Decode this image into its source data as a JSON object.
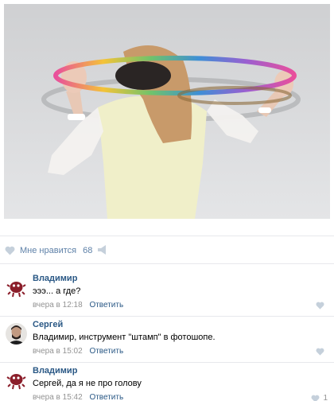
{
  "post": {
    "like_label": "Мне нравится",
    "like_count": "68"
  },
  "comments": [
    {
      "author": "Владимир",
      "text": "эээ... а где?",
      "time": "вчера в 12:18",
      "reply": "Ответить",
      "likes": ""
    },
    {
      "author": "Сергей",
      "text": "Владимир, инструмент \"штамп\" в фотошопе.",
      "time": "вчера в 15:02",
      "reply": "Ответить",
      "likes": ""
    },
    {
      "author": "Владимир",
      "text": "Сергей, да я не про голову",
      "time": "вчера в 15:42",
      "reply": "Ответить",
      "likes": "1"
    }
  ],
  "colors": {
    "link": "#2a5885",
    "like_blue": "#5e81a8",
    "muted": "#939393",
    "divider": "#e7e8ec"
  }
}
